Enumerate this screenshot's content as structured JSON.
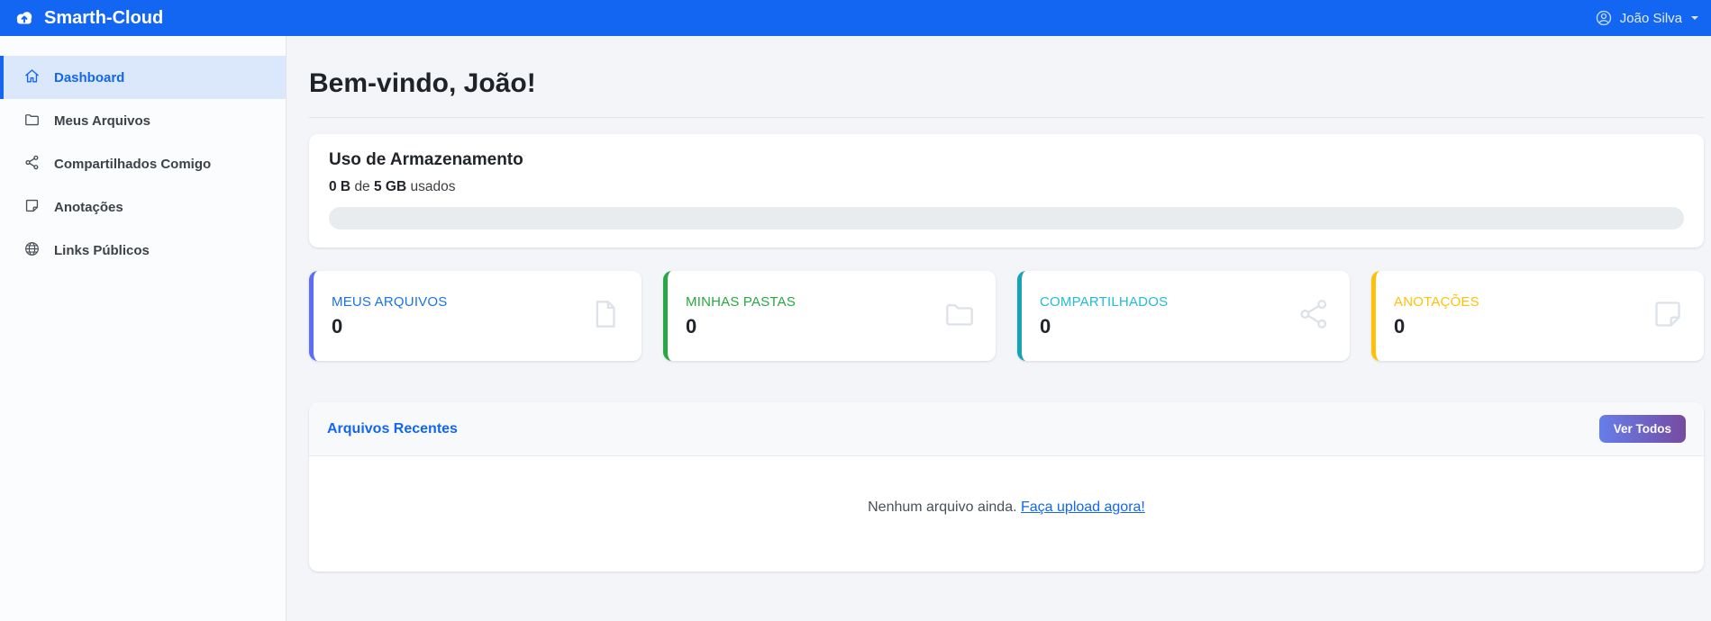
{
  "navbar": {
    "brand": "Smarth-Cloud",
    "user_name": "João Silva"
  },
  "sidebar": {
    "items": [
      {
        "label": "Dashboard",
        "icon": "house-icon",
        "active": true
      },
      {
        "label": "Meus Arquivos",
        "icon": "folder-icon",
        "active": false
      },
      {
        "label": "Compartilhados Comigo",
        "icon": "share-icon",
        "active": false
      },
      {
        "label": "Anotações",
        "icon": "note-icon",
        "active": false
      },
      {
        "label": "Links Públicos",
        "icon": "globe-icon",
        "active": false
      }
    ]
  },
  "main": {
    "welcome": "Bem-vindo, João!",
    "storage": {
      "title": "Uso de Armazenamento",
      "used": "0 B",
      "of_label": "de",
      "total": "5 GB",
      "suffix": "usados",
      "percent": 0,
      "track_color": "#e9ecef"
    },
    "stats": [
      {
        "label": "MEUS ARQUIVOS",
        "value": "0",
        "icon": "file-icon",
        "label_color": "#1a73e8",
        "border_color": "#5b6ef5"
      },
      {
        "label": "MINHAS PASTAS",
        "value": "0",
        "icon": "folder-icon",
        "label_color": "#28a745",
        "border_color": "#28a745"
      },
      {
        "label": "COMPARTILHADOS",
        "value": "0",
        "icon": "share-icon",
        "label_color": "#22bcd6",
        "border_color": "#17a2b8"
      },
      {
        "label": "ANOTAÇÕES",
        "value": "0",
        "icon": "note-icon",
        "label_color": "#ffc107",
        "border_color": "#ffc107"
      }
    ],
    "recents": {
      "title": "Arquivos Recentes",
      "button_label": "Ver Todos",
      "button_gradient": [
        "#667eea",
        "#764ba2"
      ],
      "empty_text": "Nenhum arquivo ainda.",
      "empty_link": "Faça upload agora!"
    }
  },
  "colors": {
    "navbar_bg": "#1266f1",
    "active_item_bg": "#dbe7fa",
    "page_bg": "#f3f5f9"
  }
}
